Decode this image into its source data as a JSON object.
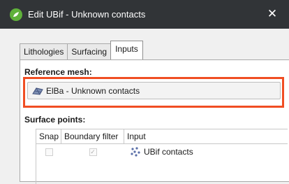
{
  "window": {
    "title": "Edit UBif - Unknown contacts",
    "close_glyph": "✕",
    "app_icon": "leapfrog-app-icon"
  },
  "tabs": [
    {
      "label": "Lithologies",
      "active": false
    },
    {
      "label": "Surfacing",
      "active": false
    },
    {
      "label": "Inputs",
      "active": true
    }
  ],
  "reference_mesh": {
    "label": "Reference mesh:",
    "value": "ElBa - Unknown contacts",
    "icon": "mesh-icon"
  },
  "surface_points": {
    "label": "Surface points:",
    "columns": [
      "Snap",
      "Boundary filter",
      "Input"
    ],
    "rows": [
      {
        "snap": false,
        "boundary_filter": true,
        "input": "UBif contacts",
        "icon": "points-icon"
      }
    ]
  },
  "colors": {
    "titlebar": "#313437",
    "highlight": "#f04e23",
    "app_icon": "#5fb13a"
  }
}
